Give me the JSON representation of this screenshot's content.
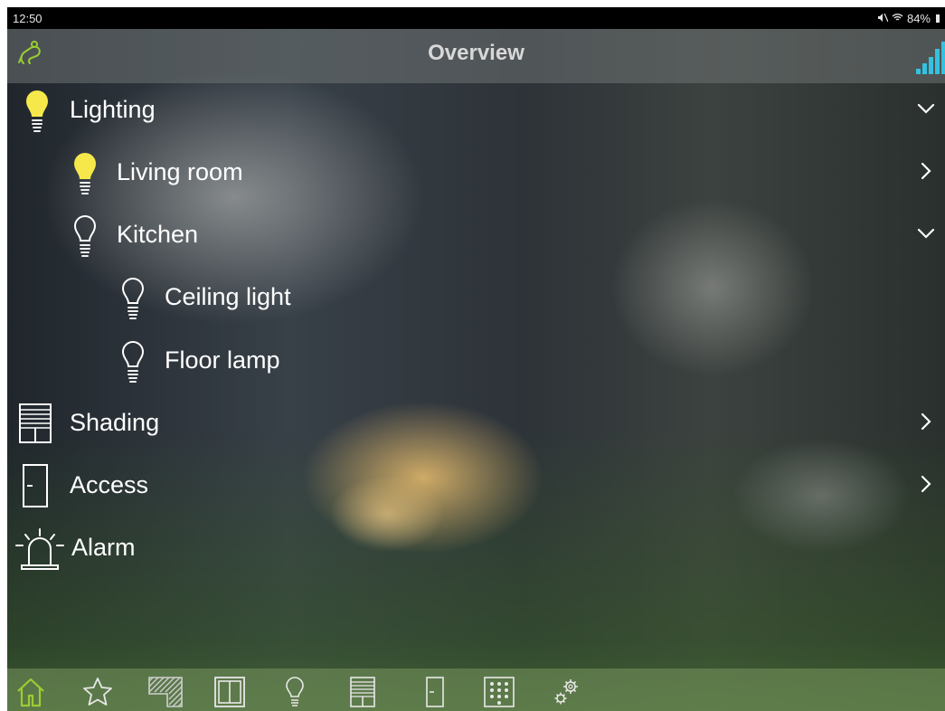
{
  "status_bar": {
    "time": "12:50",
    "mute_icon": "mute-icon",
    "wifi_icon": "wifi-icon",
    "battery": "84%"
  },
  "nav": {
    "title": "Overview",
    "left_icon": "logo-icon",
    "right_icon": "signal-strength-icon"
  },
  "list": {
    "lighting": {
      "label": "Lighting",
      "icon": "bulb-on-icon",
      "expanded": true
    },
    "living_room": {
      "label": "Living room",
      "icon": "bulb-on-icon"
    },
    "kitchen": {
      "label": "Kitchen",
      "icon": "bulb-off-icon",
      "expanded": true
    },
    "ceiling_light": {
      "label": "Ceiling light",
      "icon": "bulb-off-icon"
    },
    "floor_lamp": {
      "label": "Floor lamp",
      "icon": "bulb-off-icon"
    },
    "shading": {
      "label": "Shading",
      "icon": "blinds-icon"
    },
    "access": {
      "label": "Access",
      "icon": "door-icon"
    },
    "alarm": {
      "label": "Alarm",
      "icon": "alarm-siren-icon"
    }
  },
  "tabbar": {
    "active_tab": "home",
    "tabs": [
      "home-icon",
      "star-icon",
      "shutter-icon",
      "window-icon",
      "bulb-icon",
      "blinds-icon",
      "door-icon",
      "keypad-icon",
      "gears-icon"
    ]
  },
  "colors": {
    "accent": "#9acd32",
    "bulb_on": "#f6e84a",
    "signal": "#35c1e0",
    "text": "#ffffff"
  }
}
